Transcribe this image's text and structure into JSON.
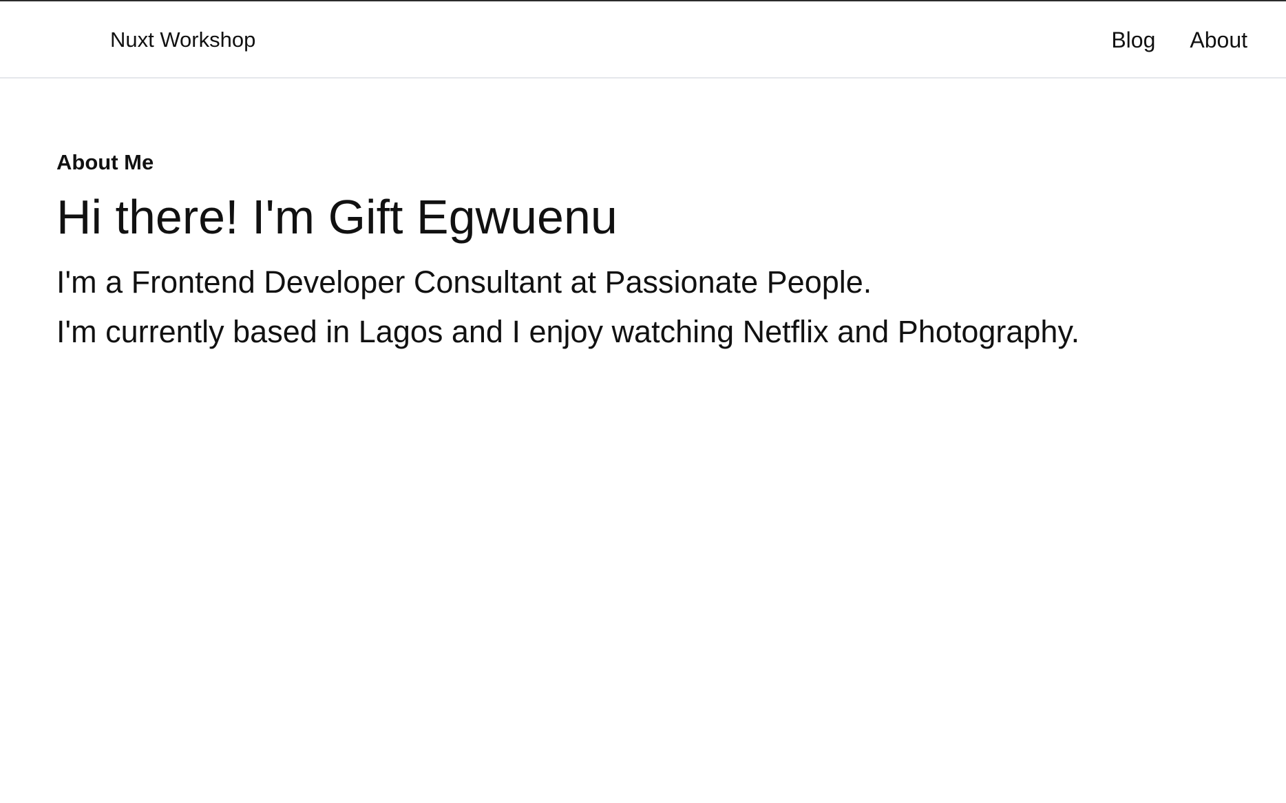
{
  "header": {
    "brand": "Nuxt Workshop",
    "nav": [
      {
        "label": "Blog"
      },
      {
        "label": "About"
      }
    ]
  },
  "main": {
    "eyebrow": "About Me",
    "headline": "Hi there! I'm Gift Egwuenu",
    "paragraphs": [
      "I'm a Frontend Developer Consultant at Passionate People.",
      "I'm currently based in Lagos and I enjoy watching Netflix and Photography."
    ]
  },
  "colors": {
    "text": "#111111",
    "background": "#ffffff",
    "header_border": "#e5e7eb",
    "top_rule": "#2b2b2b"
  }
}
